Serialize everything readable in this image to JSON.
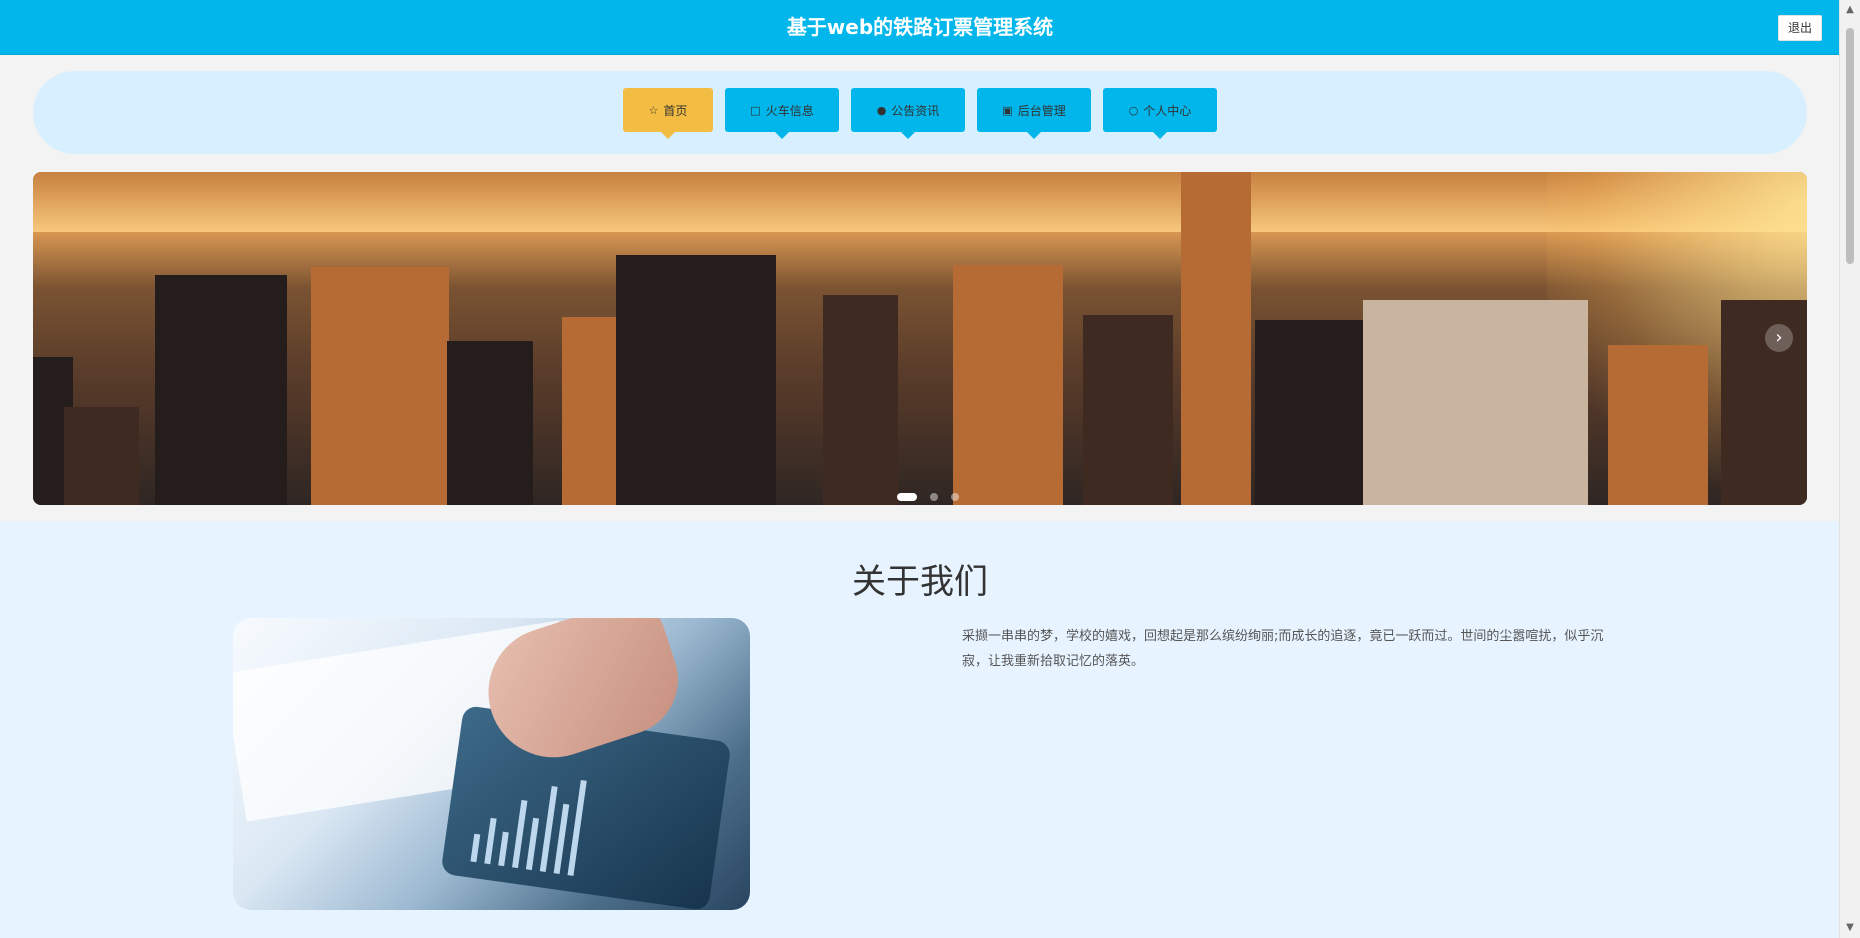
{
  "header": {
    "title": "基于web的铁路订票管理系统",
    "logout_label": "退出"
  },
  "nav": [
    {
      "label": "首页",
      "icon": "star-icon"
    },
    {
      "label": "火车信息",
      "icon": "lock-icon"
    },
    {
      "label": "公告资讯",
      "icon": "info-icon"
    },
    {
      "label": "后台管理",
      "icon": "briefcase-icon"
    },
    {
      "label": "个人中心",
      "icon": "user-icon"
    }
  ],
  "banner": {
    "next_icon": "chevron-right-icon",
    "active_slide": 1,
    "slide_count": 3
  },
  "about": {
    "title": "关于我们",
    "text": "采撷一串串的梦，学校的嬉戏，回想起是那么缤纷绚丽;而成长的追逐，竟已一跃而过。世间的尘嚣喧扰，似乎沉寂，让我重新拾取记忆的落英。"
  },
  "colors": {
    "primary": "#00b6ea",
    "active": "#f3bc42",
    "nav_background": "#d7efff",
    "section_background": "#e7f3ff"
  }
}
